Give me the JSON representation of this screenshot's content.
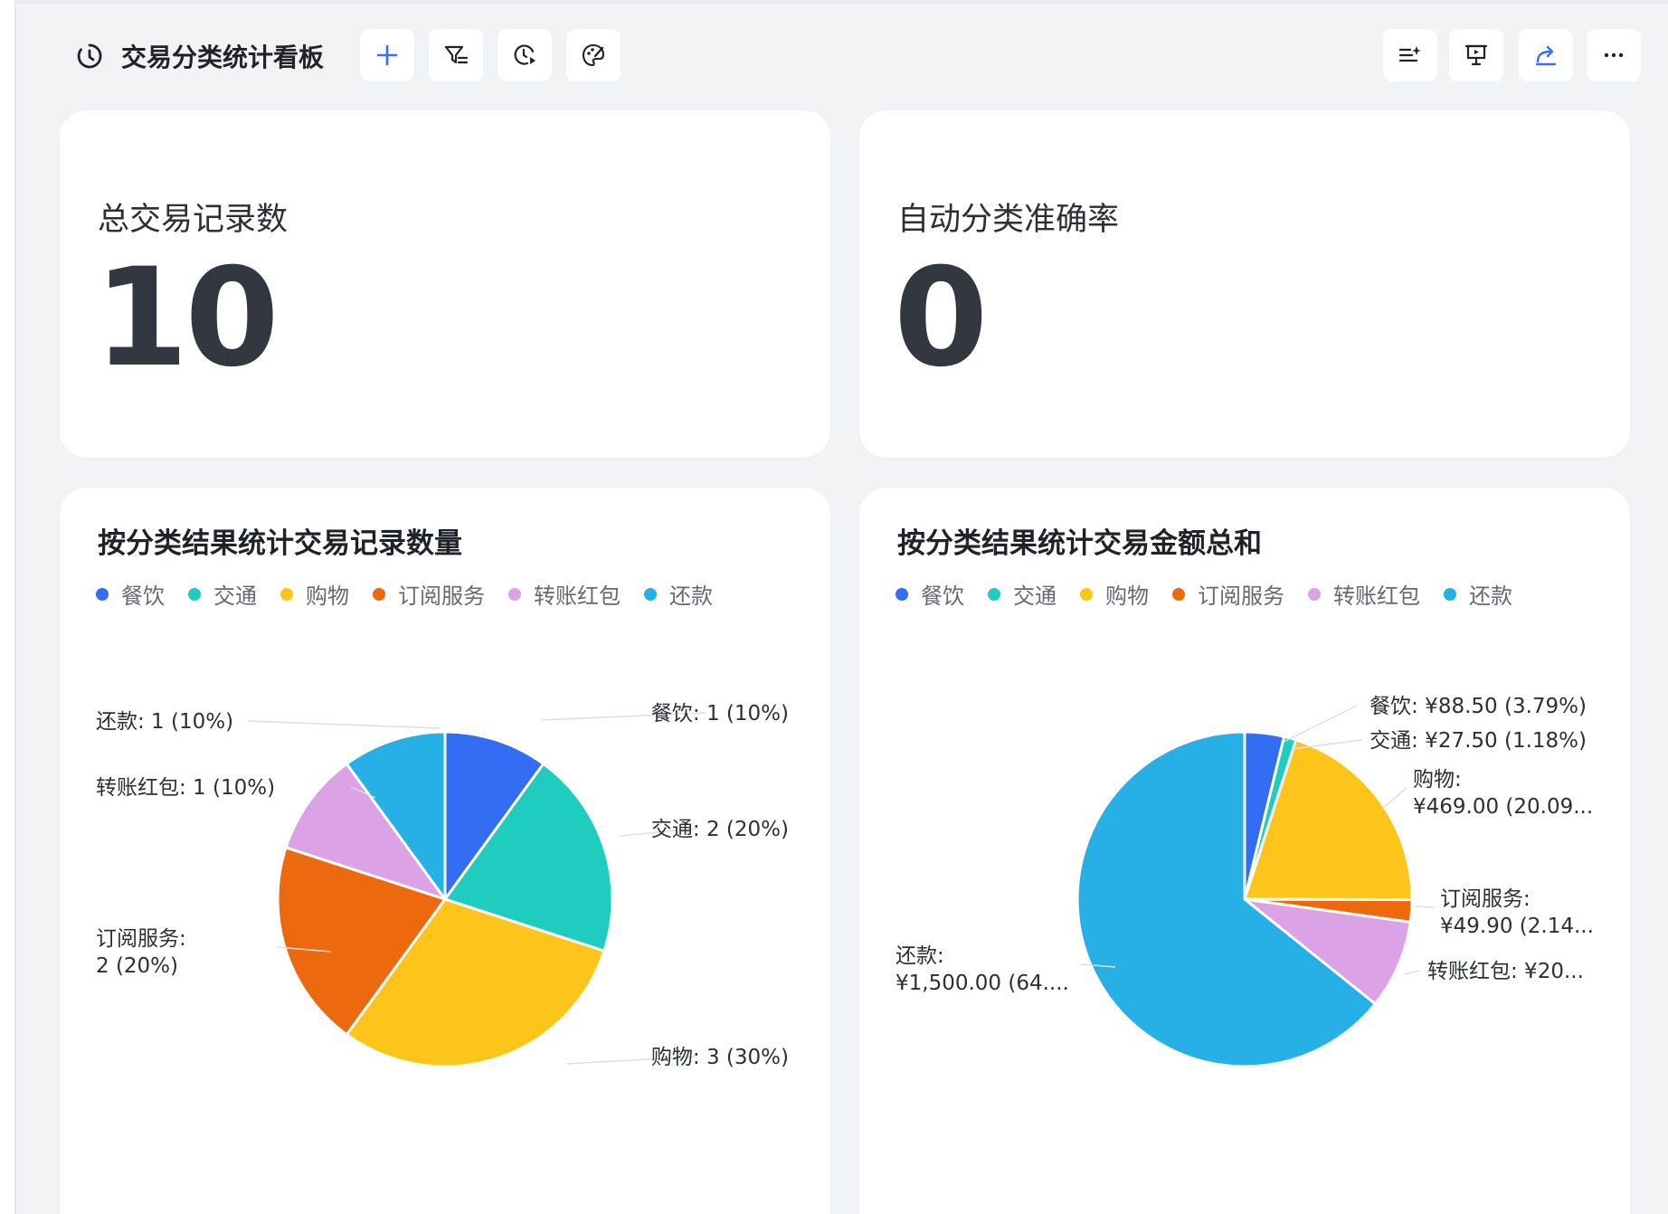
{
  "toolbar": {
    "title": "交易分类统计看板"
  },
  "metrics": [
    {
      "label": "总交易记录数",
      "value": "10"
    },
    {
      "label": "自动分类准确率",
      "value": "0"
    }
  ],
  "chart_data": [
    {
      "type": "pie",
      "title": "按分类结果统计交易记录数量",
      "categories": [
        "餐饮",
        "交通",
        "购物",
        "订阅服务",
        "转账红包",
        "还款"
      ],
      "values": [
        1,
        2,
        3,
        2,
        1,
        1
      ],
      "percent_labels": [
        "10%",
        "20%",
        "30%",
        "20%",
        "10%",
        "10%"
      ],
      "data_labels": [
        "餐饮: 1 (10%)",
        "交通: 2 (20%)",
        "购物: 3 (30%)",
        [
          "订阅服务:",
          "2 (20%)"
        ],
        "转账红包: 1 (10%)",
        "还款: 1 (10%)"
      ],
      "legend_position": "top-left",
      "colors": [
        "#336df4",
        "#1fcdbf",
        "#fdc51a",
        "#ec6a0d",
        "#dca2e6",
        "#26b0e6"
      ]
    },
    {
      "type": "pie",
      "title": "按分类结果统计交易金额总和",
      "categories": [
        "餐饮",
        "交通",
        "购物",
        "订阅服务",
        "转账红包",
        "还款"
      ],
      "values": [
        88.5,
        27.5,
        469.0,
        49.9,
        200.0,
        1500.0
      ],
      "data_labels": [
        "餐饮: ¥88.50 (3.79%)",
        "交通: ¥27.50 (1.18%)",
        [
          "购物:",
          "¥469.00 (20.09..."
        ],
        [
          "订阅服务:",
          "¥49.90 (2.14..."
        ],
        "转账红包: ¥20...",
        [
          "还款:",
          "¥1,500.00 (64...."
        ]
      ],
      "legend_position": "top-left",
      "colors": [
        "#336df4",
        "#1fcdbf",
        "#fdc51a",
        "#ec6a0d",
        "#dca2e6",
        "#26b0e6"
      ]
    }
  ]
}
